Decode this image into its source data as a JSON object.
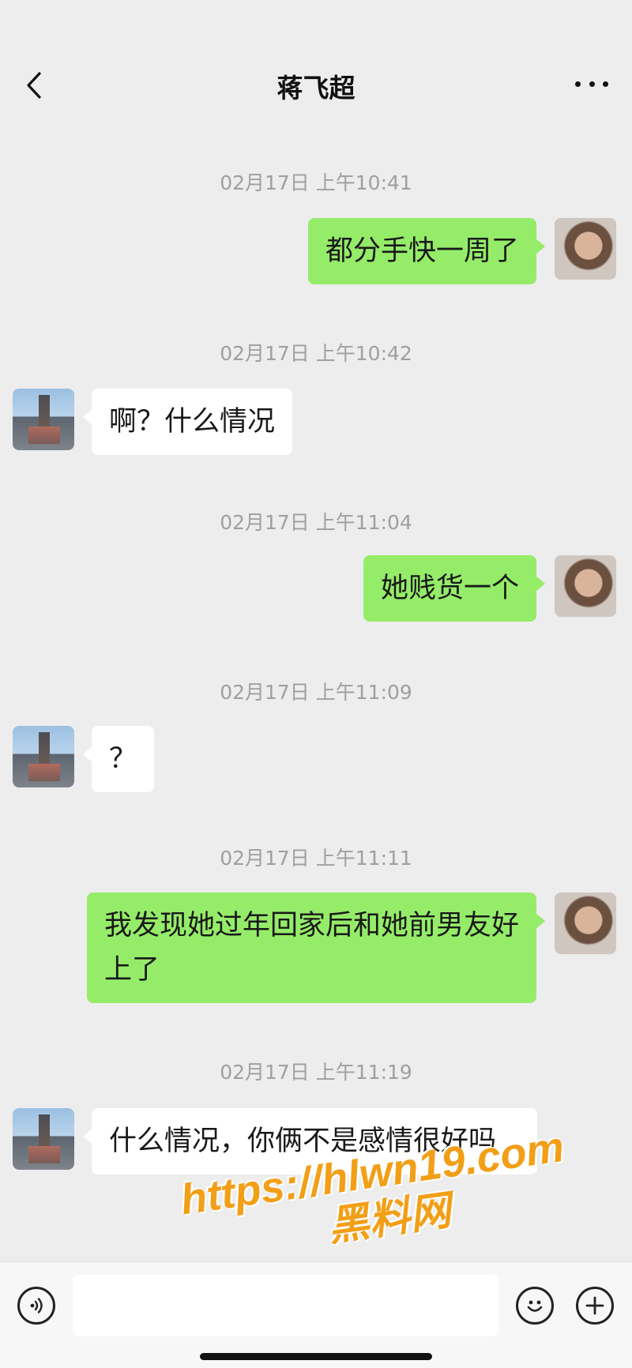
{
  "header": {
    "title": "蒋飞超",
    "back_icon": "chevron-left-icon",
    "more_icon": "more-dots-icon"
  },
  "messages": [
    {
      "timestamp": "02月17日 上午10:41",
      "sender": "me",
      "text": "都分手快一周了"
    },
    {
      "timestamp": "02月17日 上午10:42",
      "sender": "other",
      "text": "啊？什么情况"
    },
    {
      "timestamp": "02月17日 上午11:04",
      "sender": "me",
      "text": "她贱货一个"
    },
    {
      "timestamp": "02月17日 上午11:09",
      "sender": "other",
      "text": "？"
    },
    {
      "timestamp": "02月17日 上午11:11",
      "sender": "me",
      "text": "我发现她过年回家后和她前男友好上了"
    },
    {
      "timestamp": "02月17日 上午11:19",
      "sender": "other",
      "text": "什么情况，你俩不是感情很好吗"
    }
  ],
  "watermark": {
    "url": "https://hlwn19.com",
    "label": "黑料网"
  },
  "input_bar": {
    "value": "",
    "voice_icon": "voice-icon",
    "emoji_icon": "emoji-icon",
    "plus_icon": "plus-icon"
  },
  "colors": {
    "background": "#ededed",
    "bubble_me": "#95ec69",
    "bubble_other": "#ffffff",
    "timestamp": "#9f9f9f",
    "watermark": "#f29f17"
  }
}
